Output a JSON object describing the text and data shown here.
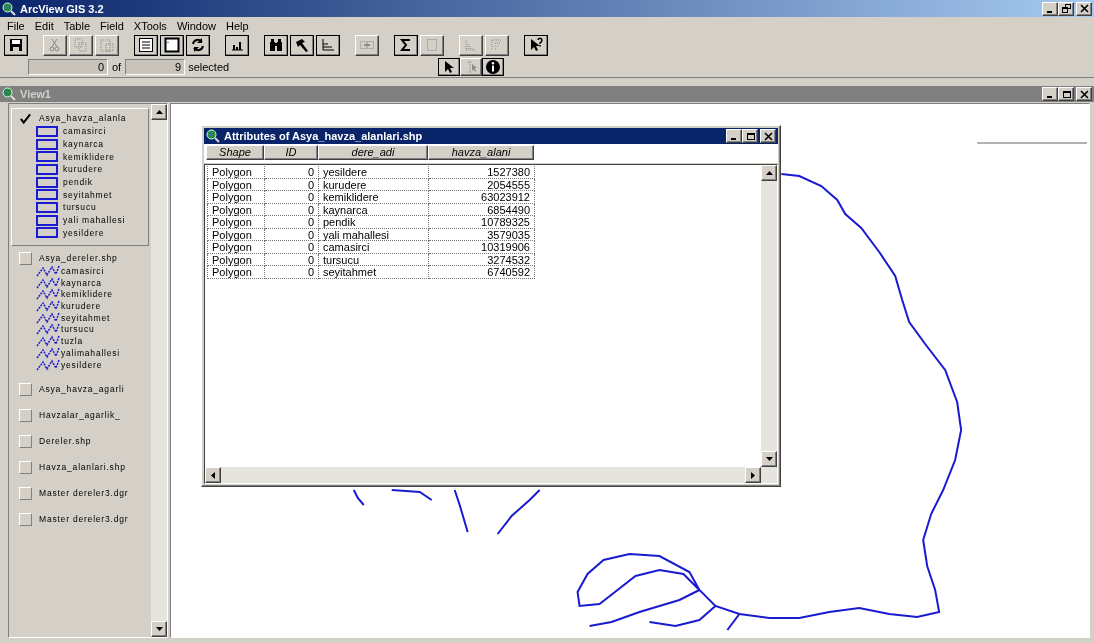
{
  "app_window": {
    "title": "ArcView GIS 3.2"
  },
  "menu": [
    "File",
    "Edit",
    "Table",
    "Field",
    "XTools",
    "Window",
    "Help"
  ],
  "toolbar": {
    "groups": [
      {
        "buttons": [
          {
            "kind": "save",
            "disabled": false
          }
        ]
      },
      {
        "buttons": [
          {
            "kind": "cut",
            "disabled": true
          },
          {
            "kind": "copy",
            "disabled": true
          },
          {
            "kind": "paste",
            "disabled": true
          }
        ]
      },
      {
        "buttons": [
          {
            "kind": "list",
            "disabled": false
          },
          {
            "kind": "window",
            "disabled": false
          },
          {
            "kind": "refresh",
            "disabled": false
          }
        ]
      },
      {
        "buttons": [
          {
            "kind": "chart",
            "disabled": false
          }
        ]
      },
      {
        "buttons": [
          {
            "kind": "find",
            "disabled": false
          },
          {
            "kind": "query",
            "disabled": false
          },
          {
            "kind": "axis",
            "disabled": false
          }
        ]
      },
      {
        "buttons": [
          {
            "kind": "join",
            "disabled": true
          }
        ]
      },
      {
        "buttons": [
          {
            "kind": "sum",
            "disabled": false
          },
          {
            "kind": "table",
            "disabled": true
          }
        ]
      },
      {
        "buttons": [
          {
            "kind": "stairs",
            "disabled": true
          },
          {
            "kind": "grid",
            "disabled": true
          }
        ]
      },
      {
        "buttons": [
          {
            "kind": "help",
            "disabled": false
          }
        ]
      }
    ]
  },
  "selection_bar": {
    "selected_count": "0",
    "of": "of",
    "total": "9",
    "label": "selected",
    "tools": [
      {
        "kind": "pointer",
        "disabled": false
      },
      {
        "kind": "vertex",
        "disabled": true
      },
      {
        "kind": "identify",
        "disabled": false
      }
    ]
  },
  "view_window": {
    "title": "View1",
    "legend": [
      {
        "name": "Asya_havza_alanla",
        "checked": true,
        "selected": true,
        "kind": "polygon",
        "classes": [
          "camasirci",
          "kaynarca",
          "kemiklidere",
          "kurudere",
          "pendik",
          "seyitahmet",
          "tursucu",
          "yali mahallesi",
          "yesildere"
        ]
      },
      {
        "name": "Asya_dereler.shp",
        "checked": false,
        "selected": false,
        "kind": "line",
        "classes": [
          "camasirci",
          "kaynarca",
          "kemiklidere",
          "kurudere",
          "seyitahmet",
          "tursucu",
          "tuzla",
          "yalimahallesi",
          "yesildere"
        ]
      },
      {
        "name": "Asya_havza_agarli",
        "checked": false,
        "selected": false
      },
      {
        "name": "Havzalar_agarlik_",
        "checked": false,
        "selected": false
      },
      {
        "name": "Dereler.shp",
        "checked": false,
        "selected": false
      },
      {
        "name": "Havza_alanlari.shp",
        "checked": false,
        "selected": false
      },
      {
        "name": "Master dereler3.dgr",
        "checked": false,
        "selected": false
      },
      {
        "name": "Master dereler3.dgr",
        "checked": false,
        "selected": false
      }
    ],
    "attributes_window": {
      "title": "Attributes of Asya_havza_alanlari.shp",
      "columns": [
        "Shape",
        "ID",
        "dere_adi",
        "havza_alani"
      ],
      "rows": [
        [
          "Polygon",
          "0",
          "yesildere",
          "1527380"
        ],
        [
          "Polygon",
          "0",
          "kurudere",
          "2054555"
        ],
        [
          "Polygon",
          "0",
          "kemiklidere",
          "63023912"
        ],
        [
          "Polygon",
          "0",
          "kaynarca",
          "6854490"
        ],
        [
          "Polygon",
          "0",
          "pendik",
          "10789325"
        ],
        [
          "Polygon",
          "0",
          "yali mahallesi",
          "3579035"
        ],
        [
          "Polygon",
          "0",
          "camasirci",
          "10319906"
        ],
        [
          "Polygon",
          "0",
          "tursucu",
          "3274532"
        ],
        [
          "Polygon",
          "0",
          "seyitahmet",
          "6740592"
        ]
      ]
    }
  }
}
